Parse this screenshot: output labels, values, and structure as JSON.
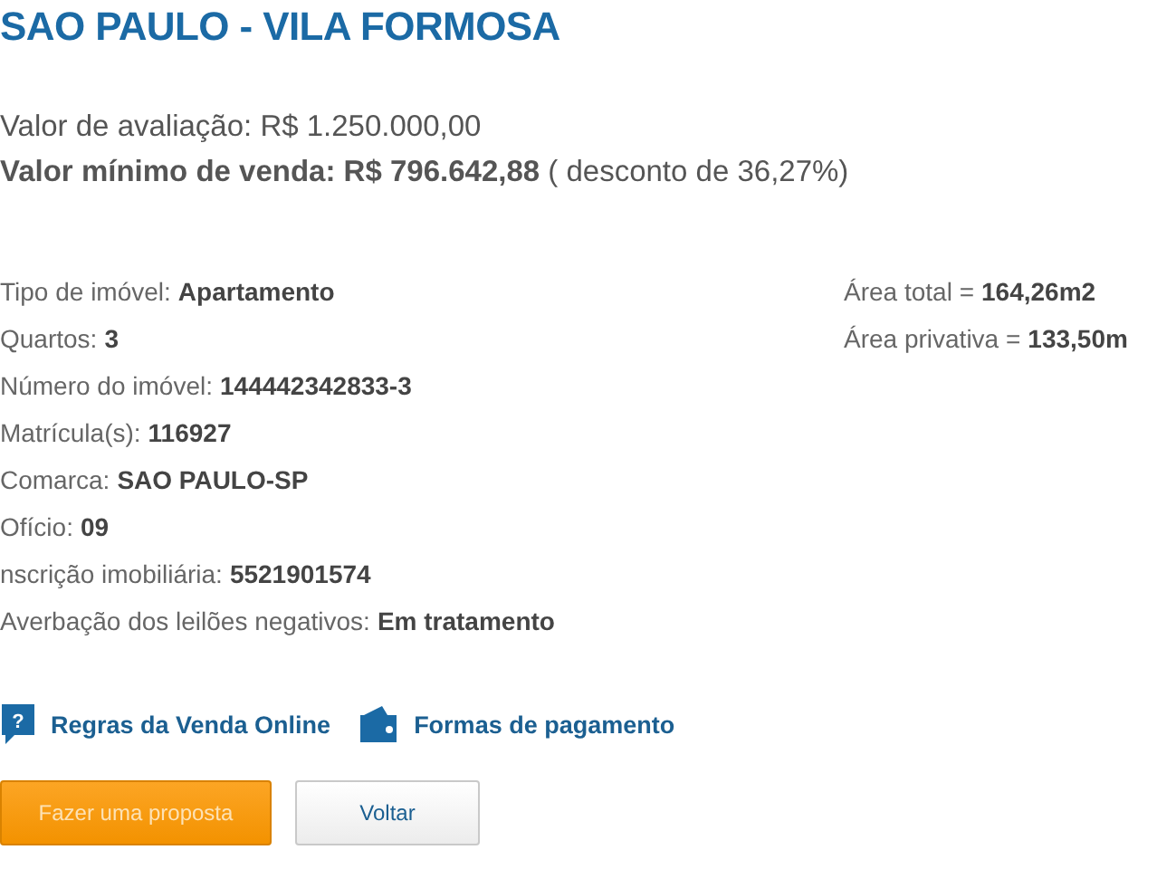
{
  "title": "SAO PAULO - VILA FORMOSA",
  "valuation": {
    "label": "Valor de avaliação:",
    "value": "R$ 1.250.000,00"
  },
  "minimum": {
    "label": "Valor mínimo de venda:",
    "value": "R$ 796.642,88",
    "note": "( desconto de 36,27%)"
  },
  "details": [
    {
      "label": "Tipo de imóvel:",
      "value": "Apartamento"
    },
    {
      "label": "Quartos:",
      "value": "3"
    },
    {
      "label": "Número do imóvel:",
      "value": "144442342833-3"
    },
    {
      "label": "Matrícula(s):",
      "value": "116927"
    },
    {
      "label": "Comarca:",
      "value": "SAO PAULO-SP"
    },
    {
      "label": "Ofício:",
      "value": "09"
    },
    {
      "label": "nscrição imobiliária:",
      "value": "5521901574"
    },
    {
      "label": "Averbação dos leilões negativos:",
      "value": "Em tratamento"
    }
  ],
  "areas": [
    {
      "label": "Área total =",
      "value": "164,26m2"
    },
    {
      "label": "Área privativa =",
      "value": "133,50m"
    }
  ],
  "links": [
    {
      "kind": "help",
      "icon_text": "?",
      "label": "Regras da Venda Online"
    },
    {
      "kind": "wallet",
      "label": "Formas de pagamento"
    }
  ],
  "buttons": [
    {
      "kind": "primary",
      "label": "Fazer uma proposta"
    },
    {
      "kind": "secondary",
      "label": "Voltar"
    }
  ]
}
